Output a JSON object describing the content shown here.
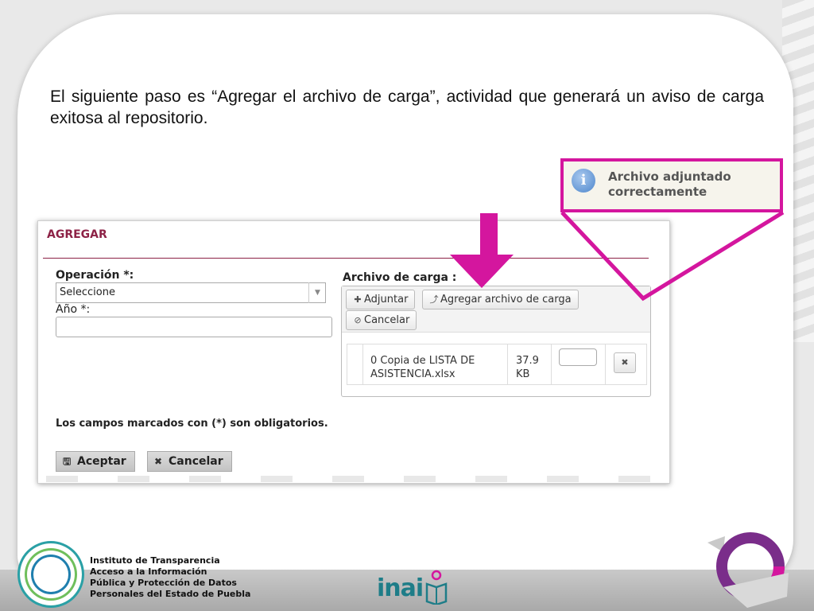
{
  "slide": {
    "instruction": "El siguiente paso es “Agregar el archivo de carga”, actividad que generará un aviso de carga exitosa al repositorio."
  },
  "notification": {
    "icon": "info-icon",
    "icon_glyph": "i",
    "message": "Archivo adjuntado correctamente"
  },
  "form": {
    "title": "AGREGAR",
    "operacion_label": "Operación *:",
    "operacion_value": "Seleccione",
    "anio_label": "Año *:",
    "anio_value": "",
    "archivo_label": "Archivo de carga :",
    "buttons": {
      "adjuntar": "Adjuntar",
      "agregar": "Agregar archivo de carga",
      "cancelar": "Cancelar"
    },
    "file": {
      "name": "0 Copia de LISTA DE ASISTENCIA.xlsx",
      "size": "37.9 KB",
      "remove_glyph": "✖"
    },
    "required_note": "Los campos marcados con (*) son obligatorios.",
    "actions": {
      "accept": "Aceptar",
      "cancel": "Cancelar"
    }
  },
  "footer": {
    "institute_lines": [
      "Instituto de Transparencia",
      "Acceso a la Información",
      "Pública y Protección de Datos",
      "Personales del Estado de Puebla"
    ],
    "brand": "inai"
  },
  "colors": {
    "highlight": "#d4169e",
    "title_accent": "#8d2246",
    "brand_teal": "#1e7d88"
  }
}
